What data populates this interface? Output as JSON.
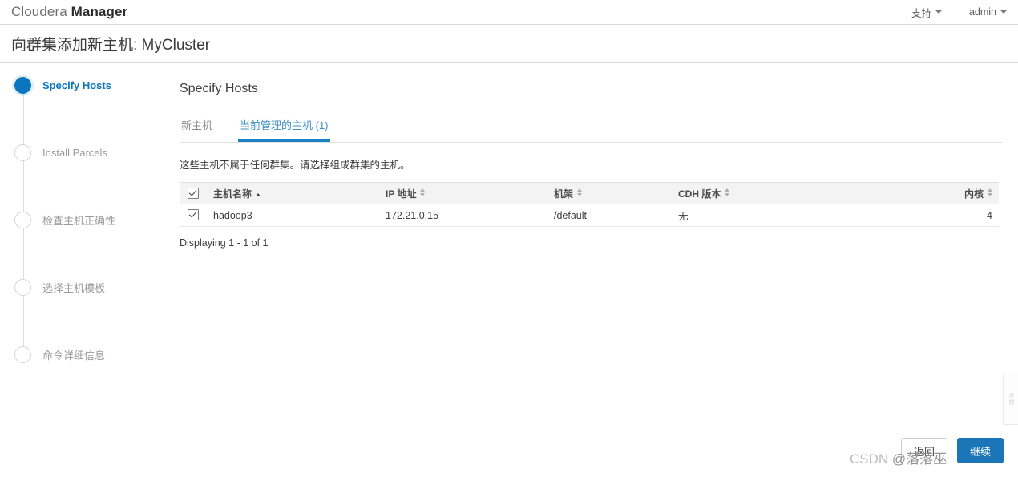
{
  "topbar": {
    "brand_prefix": "Cloudera ",
    "brand_suffix": "Manager",
    "support_label": "支持",
    "user_label": "admin"
  },
  "page": {
    "title": "向群集添加新主机: MyCluster"
  },
  "sidebar": {
    "steps": [
      {
        "label": "Specify Hosts",
        "state": "active"
      },
      {
        "label": "Install Parcels",
        "state": "pending"
      },
      {
        "label": "检查主机正确性",
        "state": "pending"
      },
      {
        "label": "选择主机模板",
        "state": "pending"
      },
      {
        "label": "命令详细信息",
        "state": "pending"
      }
    ]
  },
  "main": {
    "panel_title": "Specify Hosts",
    "tabs": [
      {
        "label": "新主机",
        "active": false
      },
      {
        "label": "当前管理的主机 (1)",
        "active": true
      }
    ],
    "hint": "这些主机不属于任何群集。请选择组成群集的主机。",
    "table": {
      "header_checkbox_checked": true,
      "columns": [
        {
          "label": "主机名称",
          "sort": "asc",
          "align": "left"
        },
        {
          "label": "IP 地址",
          "sort": "none",
          "align": "left"
        },
        {
          "label": "机架",
          "sort": "none",
          "align": "left"
        },
        {
          "label": "CDH 版本",
          "sort": "none",
          "align": "left"
        },
        {
          "label": "内核",
          "sort": "none",
          "align": "right"
        }
      ],
      "rows": [
        {
          "checked": true,
          "hostname": "hadoop3",
          "ip": "172.21.0.15",
          "rack": "/default",
          "cdh_version": "无",
          "cores": "4"
        }
      ]
    },
    "displaying": "Displaying 1 - 1 of 1"
  },
  "footer": {
    "back_label": "返回",
    "continue_label": "继续"
  },
  "feedback": {
    "label": "反馈"
  },
  "watermark": {
    "prefix": "CSDN ",
    "handle": "@落落巫"
  },
  "colors": {
    "accent": "#0b76bd",
    "tab_underline": "#1a82c4",
    "primary_button": "#1c75b6",
    "header_row": "#f3f3f4"
  }
}
